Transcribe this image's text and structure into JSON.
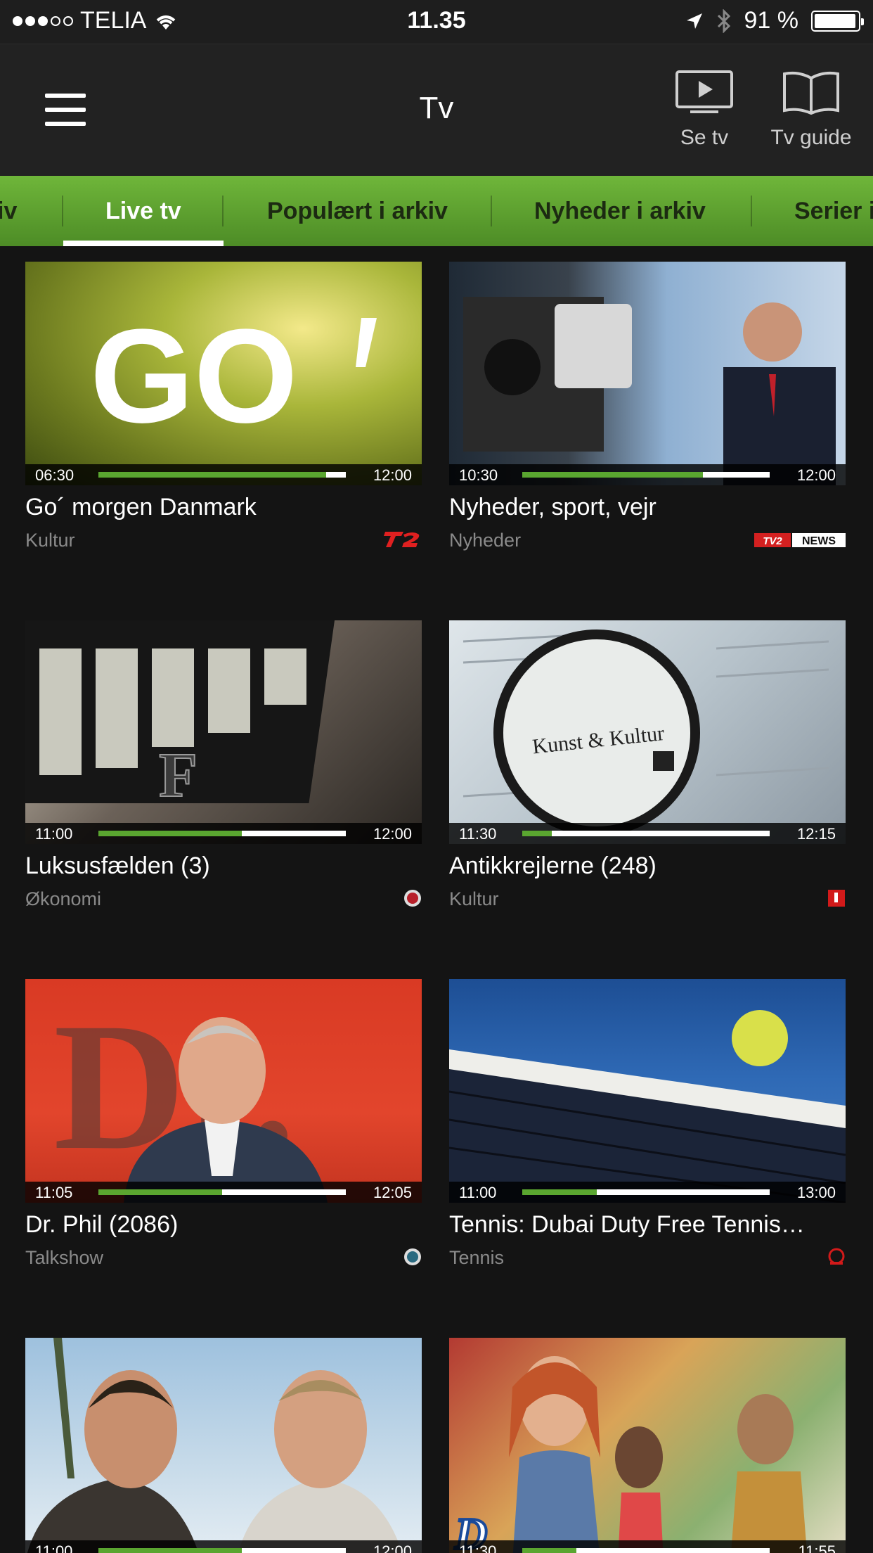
{
  "status_bar": {
    "carrier": "TELIA",
    "time": "11.35",
    "battery": "91 %"
  },
  "header": {
    "title": "Tv",
    "se_tv_label": "Se tv",
    "tv_guide_label": "Tv guide"
  },
  "tabs": [
    {
      "label": "iv"
    },
    {
      "label": "Live tv"
    },
    {
      "label": "Populært i arkiv"
    },
    {
      "label": "Nyheder i arkiv"
    },
    {
      "label": "Serier i"
    }
  ],
  "programs": [
    {
      "title": "Go´ morgen Danmark",
      "genre": "Kultur",
      "start": "06:30",
      "end": "12:00",
      "progress": 0.92,
      "channel_logo": "tv2-logo"
    },
    {
      "title": "Nyheder, sport, vejr",
      "genre": "Nyheder",
      "start": "10:30",
      "end": "12:00",
      "progress": 0.73,
      "channel_logo": "tv2-news-logo",
      "channel_text_1": "TV2",
      "channel_text_2": "NEWS"
    },
    {
      "title": "Luksusfælden (3)",
      "genre": "Økonomi",
      "start": "11:00",
      "end": "12:00",
      "progress": 0.58,
      "channel_logo": "tv3-logo"
    },
    {
      "title": "Antikkrejlerne (248)",
      "genre": "Kultur",
      "start": "11:30",
      "end": "12:15",
      "progress": 0.12,
      "channel_logo": "dr1-logo",
      "art_text": "Kunst & Kultur"
    },
    {
      "title": "Dr. Phil (2086)",
      "genre": "Talkshow",
      "start": "11:05",
      "end": "12:05",
      "progress": 0.5,
      "channel_logo": "tv3-plus-logo"
    },
    {
      "title": "Tennis: Dubai Duty Free Tennis…",
      "genre": "Tennis",
      "start": "11:00",
      "end": "13:00",
      "progress": 0.3,
      "channel_logo": "tv3-sport-logo"
    },
    {
      "title": "",
      "genre": "",
      "start": "11:00",
      "end": "12:00",
      "progress": 0.58,
      "channel_logo": ""
    },
    {
      "title": "",
      "genre": "",
      "start": "11:30",
      "end": "11:55",
      "progress": 0.22,
      "channel_logo": ""
    }
  ],
  "colors": {
    "accent_green": "#5aa630",
    "tab_bar_green": "#6fb63a",
    "background": "#141414",
    "header": "#222222"
  }
}
